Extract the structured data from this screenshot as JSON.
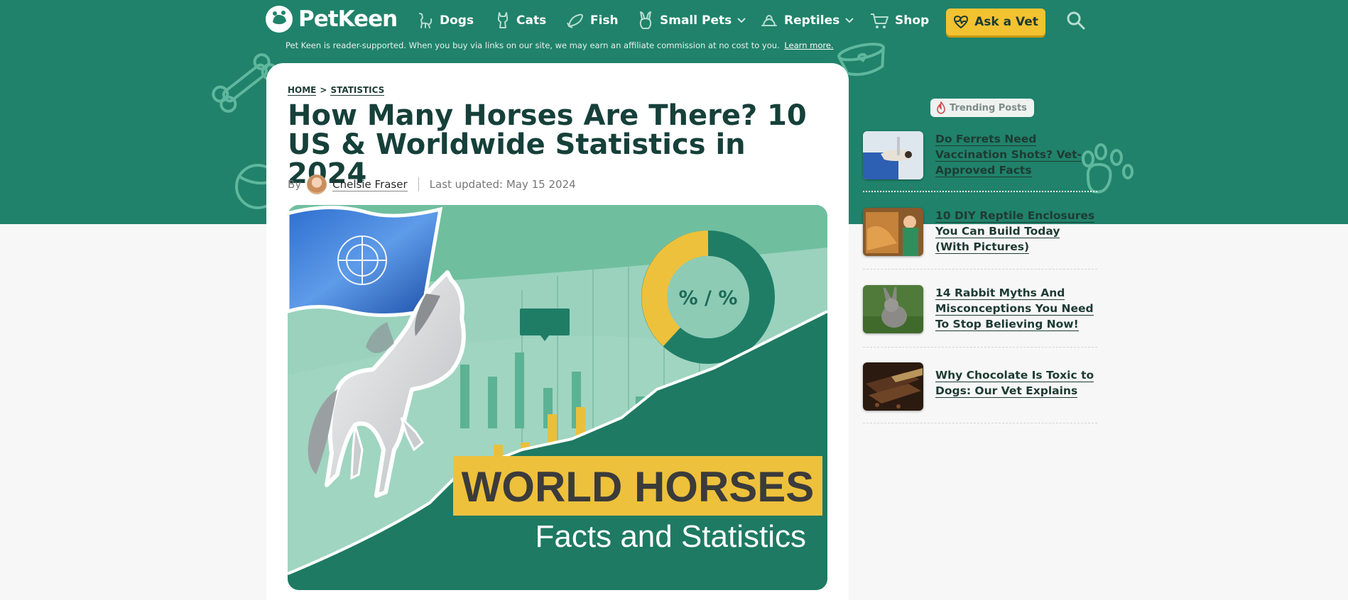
{
  "brand": {
    "name": "PetKeen"
  },
  "nav": {
    "items": [
      {
        "label": "Dogs"
      },
      {
        "label": "Cats"
      },
      {
        "label": "Fish"
      },
      {
        "label": "Small Pets"
      },
      {
        "label": "Reptiles"
      },
      {
        "label": "Shop"
      }
    ],
    "ask_vet": "Ask a Vet"
  },
  "disclaimer": {
    "text": "Pet Keen is reader-supported. When you buy via links on our site, we may earn an affiliate commission at no cost to you.",
    "link": "Learn more."
  },
  "breadcrumb": {
    "home": "HOME",
    "sep": ">",
    "section": "STATISTICS"
  },
  "article": {
    "title": "How Many Horses Are There? 10 US & Worldwide Statistics in 2024",
    "by": "By",
    "author": "Chelsie Fraser",
    "updated": "Last updated: May 15 2024"
  },
  "hero_image": {
    "donut_label": "% / %",
    "headline": "WORLD HORSES",
    "subline": "Facts and Statistics"
  },
  "trending": {
    "label": "Trending Posts",
    "posts": [
      {
        "title": "Do Ferrets Need Vaccination Shots? Vet-Approved Facts"
      },
      {
        "title": "10 DIY Reptile Enclosures You Can Build Today (With Pictures)"
      },
      {
        "title": "14 Rabbit Myths And Misconceptions You Need To Stop Believing Now!"
      },
      {
        "title": "Why Chocolate Is Toxic to Dogs: Our Vet Explains"
      }
    ]
  },
  "colors": {
    "header_green": "#20826a",
    "accent_yellow": "#f3c230",
    "text_dark": "#16403a"
  }
}
